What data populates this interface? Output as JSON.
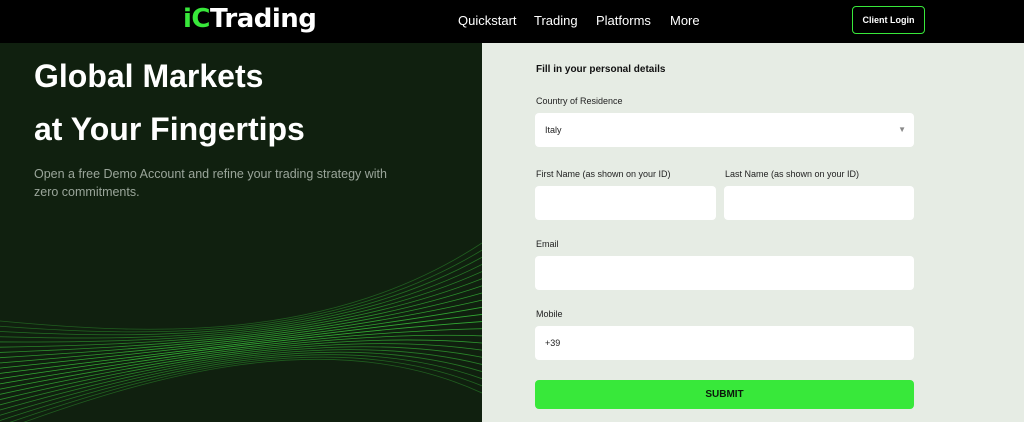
{
  "header": {
    "logo_ic": "iC",
    "logo_trading": "Trading",
    "nav": [
      "Quickstart",
      "Trading",
      "Platforms",
      "More"
    ],
    "client_login": "Client Login"
  },
  "hero": {
    "title_line1": "Global Markets",
    "title_line2": "at Your Fingertips",
    "subtitle": "Open a free Demo Account and refine your trading strategy with zero commitments."
  },
  "form": {
    "title": "Fill in your personal details",
    "country_label": "Country of Residence",
    "country_value": "Italy",
    "first_name_label": "First Name (as shown on your ID)",
    "first_name_value": "",
    "last_name_label": "Last Name (as shown on your ID)",
    "last_name_value": "",
    "email_label": "Email",
    "email_value": "",
    "mobile_label": "Mobile",
    "mobile_value": "+39",
    "submit_label": "SUBMIT"
  },
  "colors": {
    "accent": "#38e83a",
    "hero_bg": "#10200f",
    "form_bg": "#e6ece4"
  }
}
